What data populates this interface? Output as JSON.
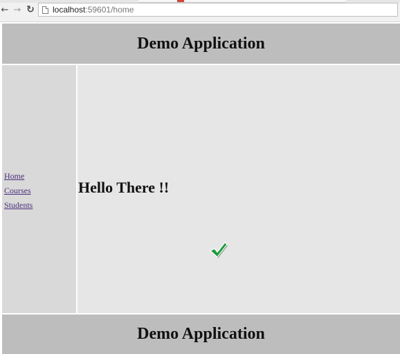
{
  "browser": {
    "url_host": "localhost",
    "url_rest": ":59601/home",
    "back_icon": "back-arrow-icon",
    "forward_icon": "forward-arrow-icon",
    "reload_icon": "reload-icon"
  },
  "header": {
    "title": "Demo Application"
  },
  "sidebar": {
    "items": [
      {
        "label": "Home"
      },
      {
        "label": "Courses"
      },
      {
        "label": "Students"
      }
    ]
  },
  "main": {
    "heading": "Hello There !!",
    "check_icon": "checkmark-icon"
  },
  "footer": {
    "title": "Demo Application"
  },
  "colors": {
    "header_bg": "#bdbdbd",
    "sidebar_bg": "#d9d9d9",
    "main_bg": "#e6e6e6",
    "link": "#4b2f7a",
    "check_green": "#1f9a3c"
  }
}
